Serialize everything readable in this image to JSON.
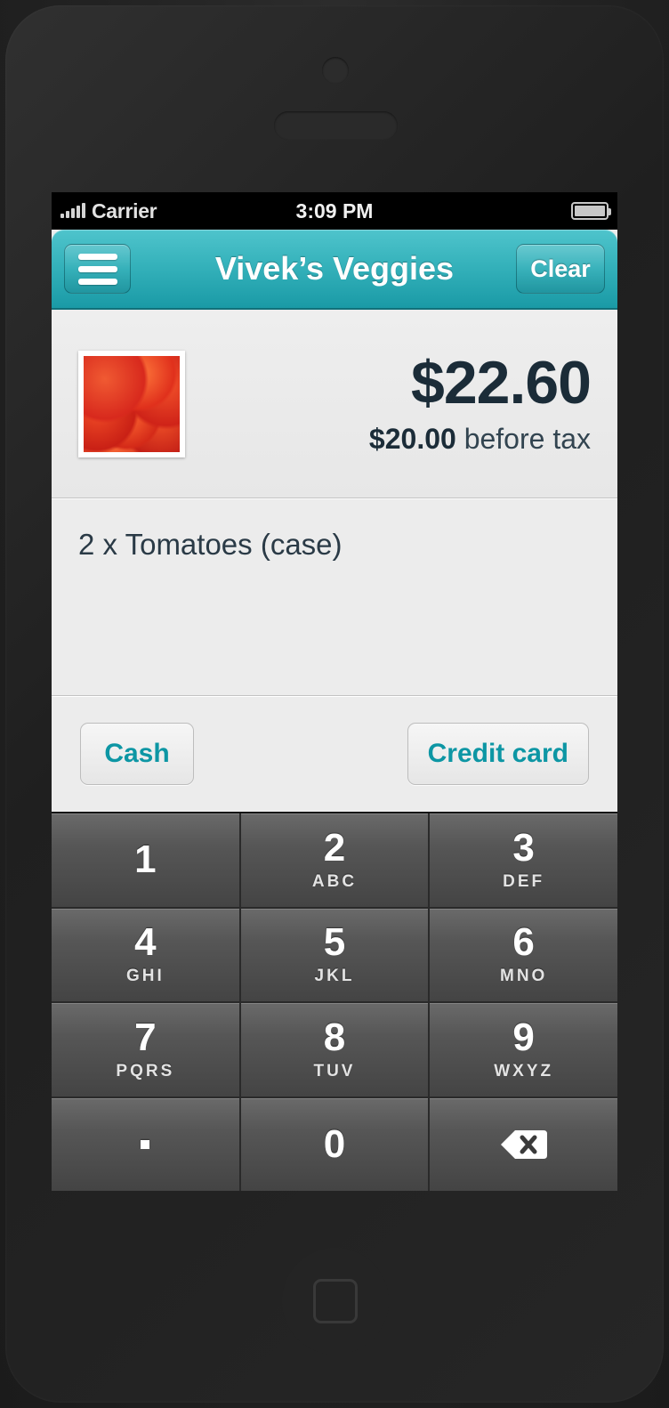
{
  "status_bar": {
    "carrier": "Carrier",
    "time": "3:09 PM",
    "signal_icon": "signal-bars-icon",
    "battery_icon": "battery-full-icon"
  },
  "header": {
    "title": "Vivek’s Veggies",
    "menu_icon": "hamburger-menu-icon",
    "clear_label": "Clear",
    "accent_color": "#35b2bb"
  },
  "price": {
    "total": "$22.60",
    "subtotal_amount": "$20.00",
    "subtotal_suffix": " before tax",
    "thumbnail_icon": "tomatoes-photo"
  },
  "items": [
    {
      "text": "2 x Tomatoes (case)"
    }
  ],
  "payment": {
    "cash_label": "Cash",
    "credit_label": "Credit card",
    "link_color": "#0d96a4"
  },
  "keypad": {
    "keys": [
      {
        "digit": "1",
        "letters": ""
      },
      {
        "digit": "2",
        "letters": "ABC"
      },
      {
        "digit": "3",
        "letters": "DEF"
      },
      {
        "digit": "4",
        "letters": "GHI"
      },
      {
        "digit": "5",
        "letters": "JKL"
      },
      {
        "digit": "6",
        "letters": "MNO"
      },
      {
        "digit": "7",
        "letters": "PQRS"
      },
      {
        "digit": "8",
        "letters": "TUV"
      },
      {
        "digit": "9",
        "letters": "WXYZ"
      },
      {
        "digit": ".",
        "letters": ""
      },
      {
        "digit": "0",
        "letters": ""
      },
      {
        "digit": "",
        "letters": "",
        "icon": "backspace-icon"
      }
    ]
  },
  "device": {
    "camera_icon": "front-camera-icon",
    "earpiece_icon": "earpiece-speaker-icon",
    "home_icon": "home-button-icon"
  }
}
